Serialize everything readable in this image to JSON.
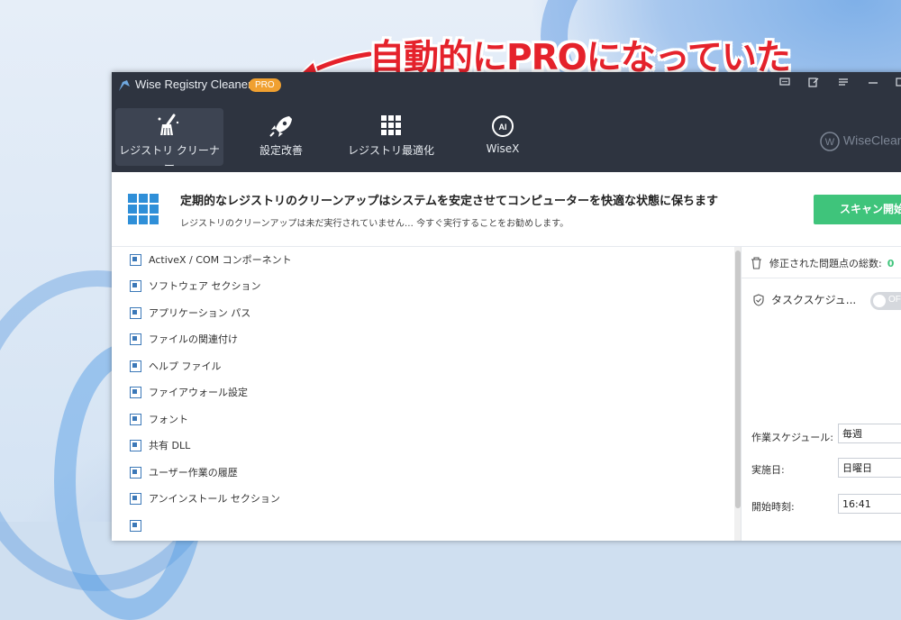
{
  "annotation": {
    "text": "自動的にPROになっていた",
    "color": "#e5222b"
  },
  "window": {
    "title": "Wise Registry Cleaner 11",
    "edition_badge": "PRO",
    "controls": [
      "feedback-icon",
      "edit-icon",
      "menu-icon",
      "minimize-icon",
      "restore-icon"
    ]
  },
  "nav": {
    "items": [
      {
        "label": "レジストリ クリーナー",
        "icon": "broom-icon",
        "active": true
      },
      {
        "label": "設定改善",
        "icon": "rocket-icon",
        "active": false
      },
      {
        "label": "レジストリ最適化",
        "icon": "grid-icon",
        "active": false
      },
      {
        "label": "WiseX",
        "icon": "ai-icon",
        "active": false
      }
    ],
    "brand": "WiseClean"
  },
  "banner": {
    "title": "定期的なレジストリのクリーンアップはシステムを安定させてコンピューターを快適な状態に保ちます",
    "subtitle": "レジストリのクリーンアップは未だ実行されていません… 今すぐ実行することをお勧めします。",
    "scan_button": "スキャン開始"
  },
  "categories": [
    "ActiveX / COM コンポーネント",
    "ソフトウェア セクション",
    "アプリケーション パス",
    "ファイルの関連付け",
    "ヘルプ ファイル",
    "ファイアウォール設定",
    "フォント",
    "共有 DLL",
    "ユーザー作業の履歴",
    "アンインストール セクション"
  ],
  "sidebar": {
    "fixed_label": "修正された問題点の総数:",
    "fixed_count": "0",
    "task_label": "タスクスケジュ...",
    "toggle_text": "OF",
    "schedule_label": "作業スケジュール:",
    "schedule_value": "毎週",
    "day_label": "実施日:",
    "day_value": "日曜日",
    "time_label": "開始時刻:",
    "time_value": "16:41"
  },
  "colors": {
    "titlebar": "#2e3440",
    "accent_green": "#3fc47b",
    "pro_badge": "#f0a030",
    "icon_blue": "#3b78b8"
  }
}
